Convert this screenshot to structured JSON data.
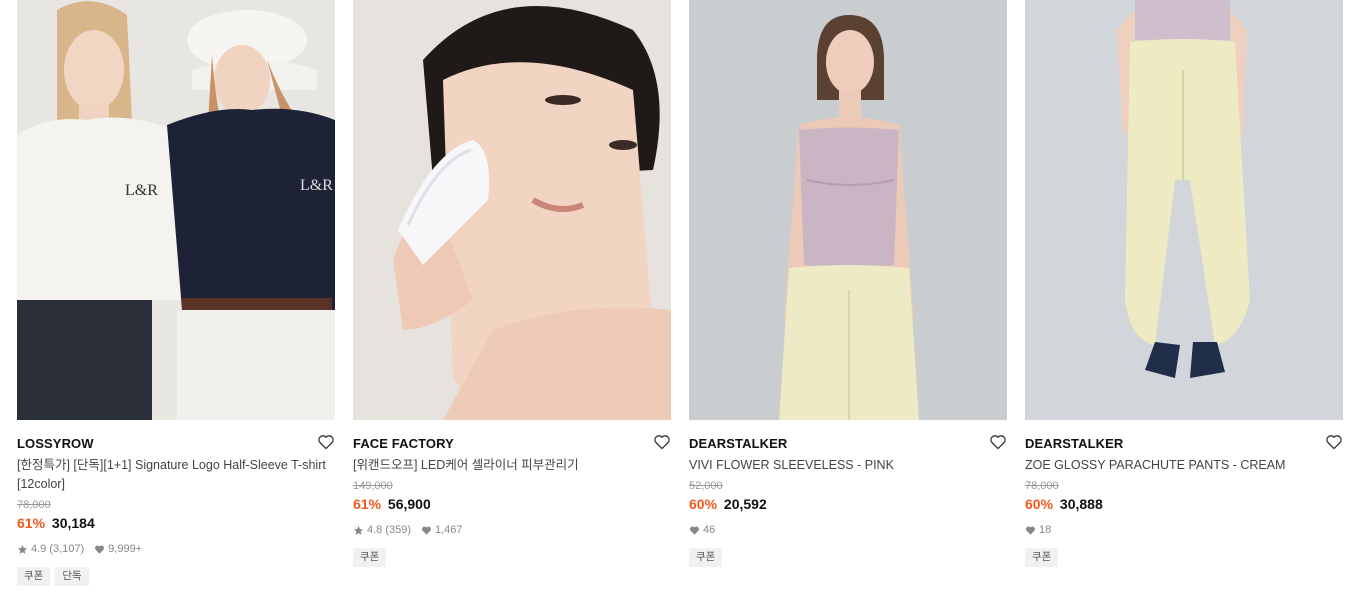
{
  "products": [
    {
      "brand": "LOSSYROW",
      "title": "[한정특가] [단독][1+1] Signature Logo Half-Sleeve T-shirt [12color]",
      "original_price": "78,000",
      "discount": "61%",
      "price": "30,184",
      "rating": "4.9",
      "reviews": "(3,107)",
      "likes": "9,999+",
      "tags": [
        "쿠폰",
        "단독"
      ],
      "heart_icon": "heart-outline-icon"
    },
    {
      "brand": "FACE FACTORY",
      "title": "[위캔드오프] LED케어 셀라이너 피부관리기",
      "original_price": "149,000",
      "discount": "61%",
      "price": "56,900",
      "rating": "4.8",
      "reviews": "(359)",
      "likes": "1,467",
      "tags": [
        "쿠폰"
      ],
      "heart_icon": "heart-outline-icon"
    },
    {
      "brand": "DEARSTALKER",
      "title": "VIVI FLOWER SLEEVELESS - PINK",
      "original_price": "52,000",
      "discount": "60%",
      "price": "20,592",
      "likes": "46",
      "tags": [
        "쿠폰"
      ],
      "heart_icon": "heart-outline-icon"
    },
    {
      "brand": "DEARSTALKER",
      "title": "ZOE GLOSSY PARACHUTE PANTS - CREAM",
      "original_price": "78,000",
      "discount": "60%",
      "price": "30,888",
      "likes": "18",
      "tags": [
        "쿠폰"
      ],
      "heart_icon": "heart-outline-icon"
    }
  ],
  "colors": {
    "discount": "#f05a1e",
    "brand": "#111111",
    "muted": "#888888"
  }
}
